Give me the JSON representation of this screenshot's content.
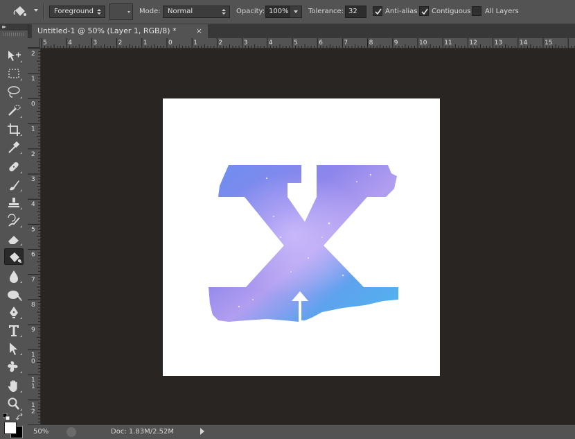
{
  "options_bar": {
    "tool_icon": "paint-bucket-icon",
    "fill_source": "Foreground",
    "mode_label": "Mode:",
    "mode_value": "Normal",
    "opacity_label": "Opacity:",
    "opacity_value": "100%",
    "tolerance_label": "Tolerance:",
    "tolerance_value": "32",
    "anti_alias": {
      "label": "Anti-alias",
      "checked": true
    },
    "contiguous": {
      "label": "Contiguous",
      "checked": true
    },
    "all_layers": {
      "label": "All Layers",
      "checked": false
    }
  },
  "document_tab": {
    "title": "Untitled-1 @ 50% (Layer 1, RGB/8) *",
    "close": "×"
  },
  "toolbar_header": "▸▸",
  "tools": [
    {
      "name": "move-tool-icon"
    },
    {
      "name": "marquee-tool-icon"
    },
    {
      "name": "lasso-tool-icon"
    },
    {
      "name": "quick-selection-tool-icon"
    },
    {
      "name": "crop-tool-icon"
    },
    {
      "name": "eyedropper-tool-icon"
    },
    {
      "name": "healing-brush-tool-icon"
    },
    {
      "name": "brush-tool-icon"
    },
    {
      "name": "clone-stamp-tool-icon"
    },
    {
      "name": "history-brush-tool-icon"
    },
    {
      "name": "eraser-tool-icon"
    },
    {
      "name": "paint-bucket-tool-icon",
      "active": true
    },
    {
      "name": "blur-tool-icon"
    },
    {
      "name": "dodge-tool-icon"
    },
    {
      "name": "pen-tool-icon"
    },
    {
      "name": "type-tool-icon"
    },
    {
      "name": "path-selection-tool-icon"
    },
    {
      "name": "custom-shape-tool-icon"
    },
    {
      "name": "hand-tool-icon"
    },
    {
      "name": "zoom-tool-icon"
    }
  ],
  "ruler": {
    "horizontal_labels": [
      "5",
      "4",
      "3",
      "2",
      "1",
      "0",
      "1",
      "2",
      "3",
      "4",
      "5",
      "6",
      "7",
      "8",
      "9",
      "10",
      "11",
      "12",
      "13",
      "14",
      "15"
    ],
    "vertical_labels": [
      "2",
      "1",
      "0",
      "1",
      "2",
      "3",
      "4",
      "5",
      "6",
      "7",
      "8",
      "9",
      "10",
      "11",
      "12"
    ]
  },
  "status_bar": {
    "zoom": "50%",
    "doc_size": "Doc: 1.83M/2.52M"
  },
  "colors": {
    "ui_panel": "#535353",
    "workspace": "#282522",
    "foreground_swatch": "#ffffff",
    "background_swatch": "#000000",
    "watercolor_blue": "#4f8fe8",
    "watercolor_purple": "#8a7ce6"
  }
}
